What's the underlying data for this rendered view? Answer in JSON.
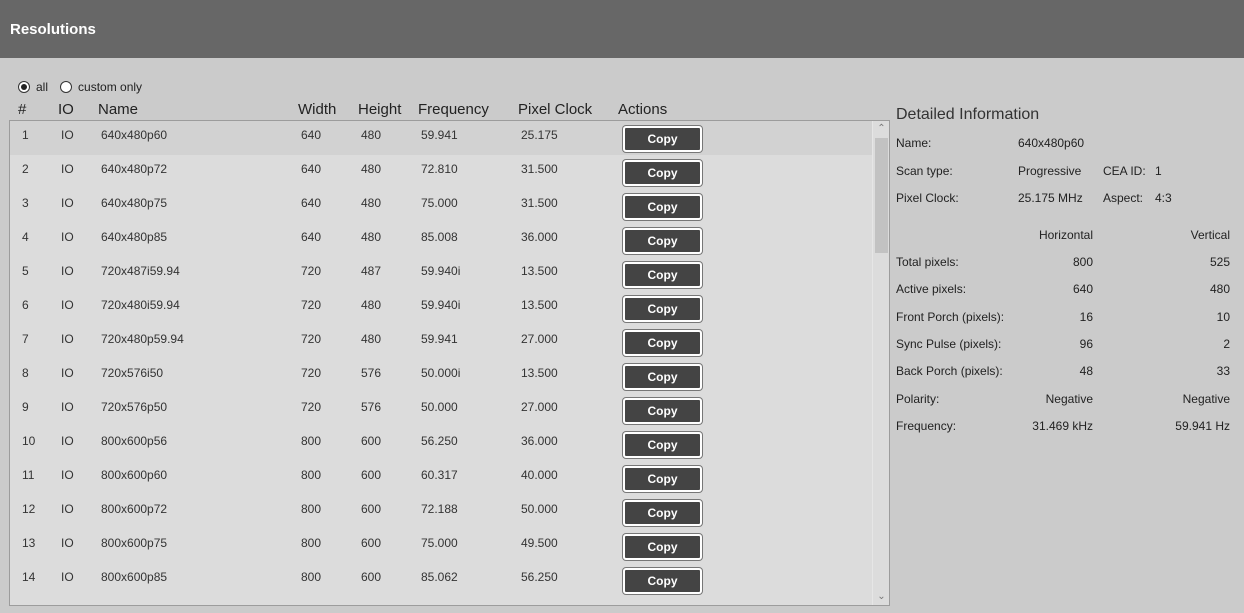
{
  "header": {
    "title": "Resolutions"
  },
  "filter": {
    "all_label": "all",
    "custom_label": "custom only",
    "selected": "all"
  },
  "columns": {
    "num": "#",
    "io": "IO",
    "name": "Name",
    "width": "Width",
    "height": "Height",
    "frequency": "Frequency",
    "pixel_clock": "Pixel Clock",
    "actions": "Actions"
  },
  "copy_label": "Copy",
  "rows": [
    {
      "num": "1",
      "io": "IO",
      "name": "640x480p60",
      "width": "640",
      "height": "480",
      "frequency": "59.941",
      "pixel_clock": "25.175"
    },
    {
      "num": "2",
      "io": "IO",
      "name": "640x480p72",
      "width": "640",
      "height": "480",
      "frequency": "72.810",
      "pixel_clock": "31.500"
    },
    {
      "num": "3",
      "io": "IO",
      "name": "640x480p75",
      "width": "640",
      "height": "480",
      "frequency": "75.000",
      "pixel_clock": "31.500"
    },
    {
      "num": "4",
      "io": "IO",
      "name": "640x480p85",
      "width": "640",
      "height": "480",
      "frequency": "85.008",
      "pixel_clock": "36.000"
    },
    {
      "num": "5",
      "io": "IO",
      "name": "720x487i59.94",
      "width": "720",
      "height": "487",
      "frequency": "59.940i",
      "pixel_clock": "13.500"
    },
    {
      "num": "6",
      "io": "IO",
      "name": "720x480i59.94",
      "width": "720",
      "height": "480",
      "frequency": "59.940i",
      "pixel_clock": "13.500"
    },
    {
      "num": "7",
      "io": "IO",
      "name": "720x480p59.94",
      "width": "720",
      "height": "480",
      "frequency": "59.941",
      "pixel_clock": "27.000"
    },
    {
      "num": "8",
      "io": "IO",
      "name": "720x576i50",
      "width": "720",
      "height": "576",
      "frequency": "50.000i",
      "pixel_clock": "13.500"
    },
    {
      "num": "9",
      "io": "IO",
      "name": "720x576p50",
      "width": "720",
      "height": "576",
      "frequency": "50.000",
      "pixel_clock": "27.000"
    },
    {
      "num": "10",
      "io": "IO",
      "name": "800x600p56",
      "width": "800",
      "height": "600",
      "frequency": "56.250",
      "pixel_clock": "36.000"
    },
    {
      "num": "11",
      "io": "IO",
      "name": "800x600p60",
      "width": "800",
      "height": "600",
      "frequency": "60.317",
      "pixel_clock": "40.000"
    },
    {
      "num": "12",
      "io": "IO",
      "name": "800x600p72",
      "width": "800",
      "height": "600",
      "frequency": "72.188",
      "pixel_clock": "50.000"
    },
    {
      "num": "13",
      "io": "IO",
      "name": "800x600p75",
      "width": "800",
      "height": "600",
      "frequency": "75.000",
      "pixel_clock": "49.500"
    },
    {
      "num": "14",
      "io": "IO",
      "name": "800x600p85",
      "width": "800",
      "height": "600",
      "frequency": "85.062",
      "pixel_clock": "56.250"
    }
  ],
  "details": {
    "title": "Detailed Information",
    "name_label": "Name:",
    "name_value": "640x480p60",
    "scan_label": "Scan type:",
    "scan_value": "Progressive",
    "cea_label": "CEA ID:",
    "cea_value": "1",
    "pixel_clock_label": "Pixel Clock:",
    "pixel_clock_value": "25.175 MHz",
    "aspect_label": "Aspect:",
    "aspect_value": "4:3",
    "horizontal_label": "Horizontal",
    "vertical_label": "Vertical",
    "table": [
      {
        "label": "Total pixels:",
        "h": "800",
        "v": "525"
      },
      {
        "label": "Active pixels:",
        "h": "640",
        "v": "480"
      },
      {
        "label": "Front Porch (pixels):",
        "h": "16",
        "v": "10"
      },
      {
        "label": "Sync Pulse (pixels):",
        "h": "96",
        "v": "2"
      },
      {
        "label": "Back Porch (pixels):",
        "h": "48",
        "v": "33"
      },
      {
        "label": "Polarity:",
        "h": "Negative",
        "v": "Negative"
      },
      {
        "label": "Frequency:",
        "h": "31.469 kHz",
        "v": "59.941 Hz"
      }
    ]
  },
  "icons": {
    "scroll_up": "chevron-up-icon",
    "scroll_down": "chevron-down-icon"
  }
}
